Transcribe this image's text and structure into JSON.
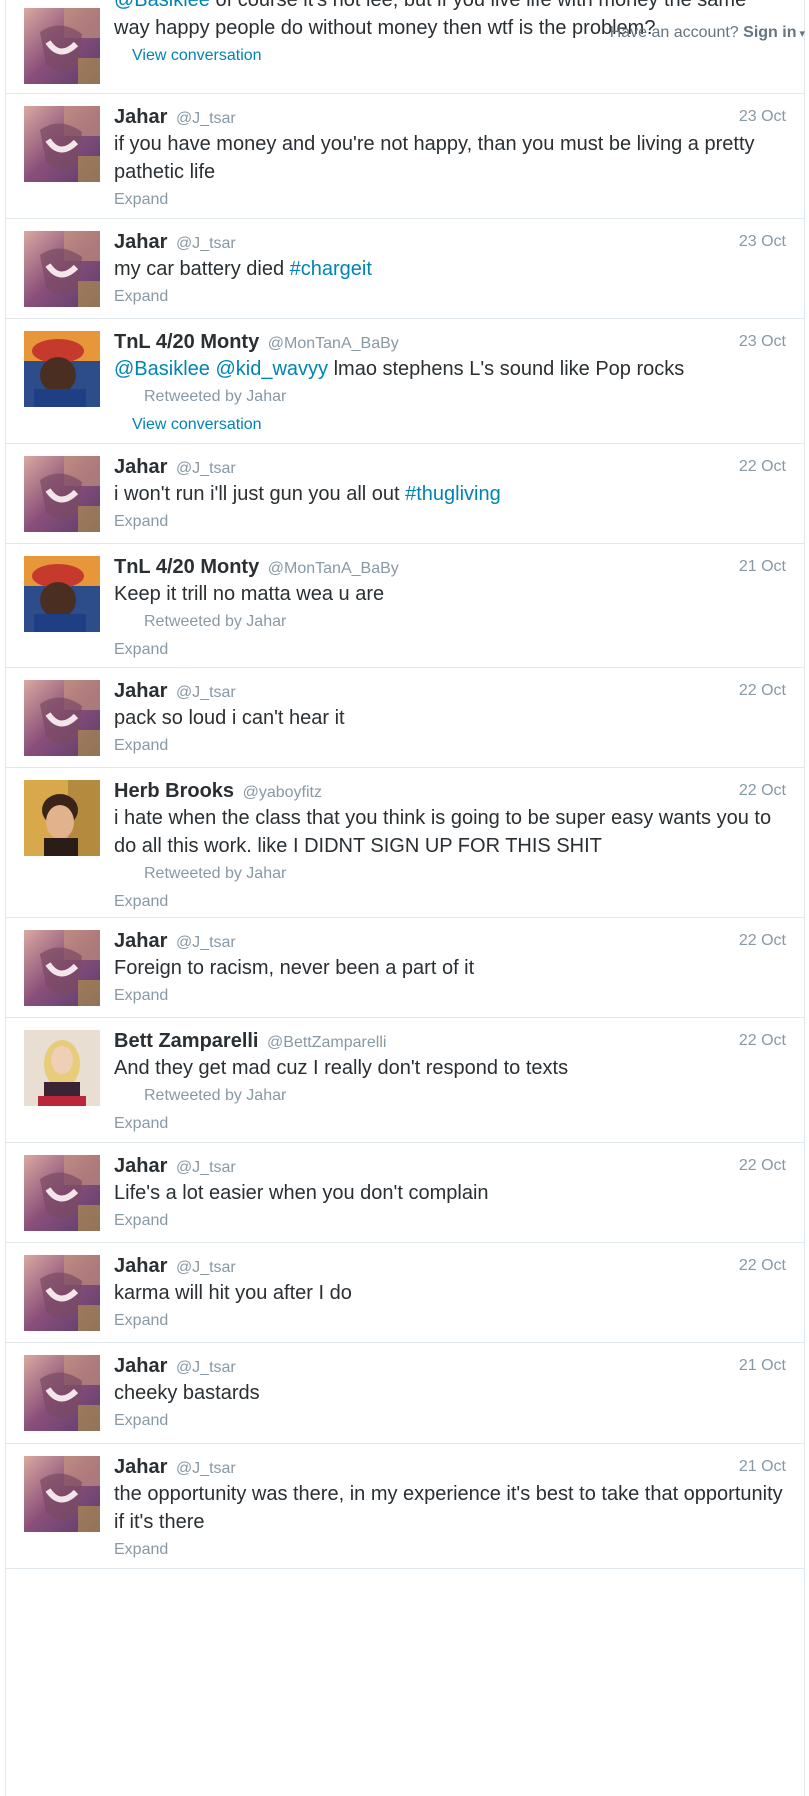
{
  "header": {
    "have_account": "Have an account?",
    "signin": "Sign in",
    "caret": "▾"
  },
  "labels": {
    "expand": "Expand",
    "view_conversation": "View conversation",
    "retweeted_prefix": "Retweeted by"
  },
  "colors": {
    "link": "#0084b4",
    "muted": "#8899a6",
    "text": "#292f33",
    "divider": "#e1e8ed"
  },
  "tweets": [
    {
      "text_parts": [
        {
          "t": "@Basiklee",
          "k": "mention"
        },
        {
          "t": " of course it's not lee, but if you live life with money the same way happy people do without money then wtf is the problem?"
        }
      ],
      "action": "View conversation",
      "avatar": "jahar"
    },
    {
      "name": "Jahar",
      "handle": "@J_tsar",
      "date": "23 Oct",
      "text_parts": [
        {
          "t": "if you have money and you're not happy, than you must be living a pretty pathetic life"
        }
      ],
      "action": "Expand",
      "avatar": "jahar"
    },
    {
      "name": "Jahar",
      "handle": "@J_tsar",
      "date": "23 Oct",
      "text_parts": [
        {
          "t": "my car battery died "
        },
        {
          "t": "#chargeit",
          "k": "tag"
        }
      ],
      "action": "Expand",
      "avatar": "jahar"
    },
    {
      "name": "TnL 4/20 Monty",
      "handle": "@MonTanA_BaBy",
      "date": "23 Oct",
      "text_parts": [
        {
          "t": "@Basiklee",
          "k": "mention"
        },
        {
          "t": " "
        },
        {
          "t": "@kid_wavyy",
          "k": "mention"
        },
        {
          "t": " lmao stephens L's sound like Pop rocks"
        }
      ],
      "retweeted_by": "Jahar",
      "action": "View conversation",
      "avatar": "monty"
    },
    {
      "name": "Jahar",
      "handle": "@J_tsar",
      "date": "22 Oct",
      "text_parts": [
        {
          "t": "i won't run i'll just gun you all out "
        },
        {
          "t": "#thugliving",
          "k": "tag"
        }
      ],
      "action": "Expand",
      "avatar": "jahar"
    },
    {
      "name": "TnL 4/20 Monty",
      "handle": "@MonTanA_BaBy",
      "date": "21 Oct",
      "text_parts": [
        {
          "t": "Keep it trill no matta wea u are"
        }
      ],
      "retweeted_by": "Jahar",
      "action": "Expand",
      "avatar": "monty"
    },
    {
      "name": "Jahar",
      "handle": "@J_tsar",
      "date": "22 Oct",
      "text_parts": [
        {
          "t": "pack so loud i can't hear it"
        }
      ],
      "action": "Expand",
      "avatar": "jahar"
    },
    {
      "name": "Herb Brooks",
      "handle": "@yaboyfitz",
      "date": "22 Oct",
      "text_parts": [
        {
          "t": "i hate when the class that you think is going to be super easy wants you to do all this work. like I DIDNT SIGN UP FOR THIS SHIT"
        }
      ],
      "retweeted_by": "Jahar",
      "action": "Expand",
      "avatar": "herb"
    },
    {
      "name": "Jahar",
      "handle": "@J_tsar",
      "date": "22 Oct",
      "text_parts": [
        {
          "t": "Foreign to racism, never been a part of it"
        }
      ],
      "action": "Expand",
      "avatar": "jahar"
    },
    {
      "name": "Bett Zamparelli",
      "handle": "@BettZamparelli",
      "date": "22 Oct",
      "text_parts": [
        {
          "t": "And they get mad cuz I really don't respond to texts"
        }
      ],
      "retweeted_by": "Jahar",
      "action": "Expand",
      "avatar": "bett"
    },
    {
      "name": "Jahar",
      "handle": "@J_tsar",
      "date": "22 Oct",
      "text_parts": [
        {
          "t": "Life's a lot easier when you don't complain"
        }
      ],
      "action": "Expand",
      "avatar": "jahar"
    },
    {
      "name": "Jahar",
      "handle": "@J_tsar",
      "date": "22 Oct",
      "text_parts": [
        {
          "t": "karma will hit you after I do"
        }
      ],
      "action": "Expand",
      "avatar": "jahar"
    },
    {
      "name": "Jahar",
      "handle": "@J_tsar",
      "date": "21 Oct",
      "text_parts": [
        {
          "t": "cheeky bastards"
        }
      ],
      "action": "Expand",
      "avatar": "jahar"
    },
    {
      "name": "Jahar",
      "handle": "@J_tsar",
      "date": "21 Oct",
      "text_parts": [
        {
          "t": "the opportunity was there, in my experience it's best to take that opportunity if it's there"
        }
      ],
      "action": "Expand",
      "avatar": "jahar"
    }
  ]
}
